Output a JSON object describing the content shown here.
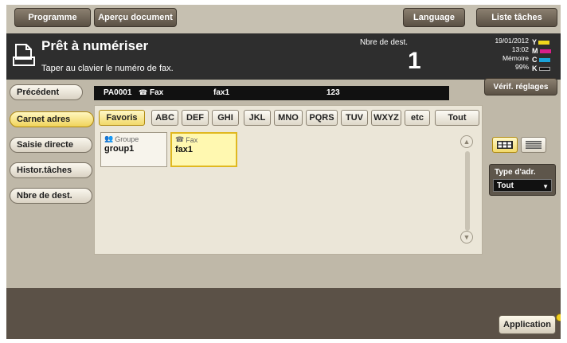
{
  "topbar": {
    "programme": "Programme",
    "apercu": "Aperçu document",
    "language": "Language",
    "liste_taches": "Liste tâches"
  },
  "status": {
    "title": "Prêt à numériser",
    "subtitle": "Taper au clavier le numéro de fax.",
    "dest_label": "Nbre de dest.",
    "dest_count": "1",
    "date": "19/01/2012",
    "time": "13:02",
    "memory_label": "Mémoire",
    "memory_value": "99%",
    "toner": [
      {
        "letter": "Y",
        "color": "#f1d71c"
      },
      {
        "letter": "M",
        "color": "#d81f8a"
      },
      {
        "letter": "C",
        "color": "#1aa3d9"
      },
      {
        "letter": "K",
        "color": "#111111"
      }
    ]
  },
  "nav": {
    "precedent": "Précédent",
    "carnet": "Carnet adres",
    "saisie": "Saisie directe",
    "histor": "Histor.tâches",
    "nbre": "Nbre de dest."
  },
  "faxbar": {
    "id": "PA0001",
    "type": "Fax",
    "name": "fax1",
    "number": "123"
  },
  "verif": "Vérif. réglages",
  "filters": [
    "Favoris",
    "ABC",
    "DEF",
    "GHI",
    "JKL",
    "MNO",
    "PQRS",
    "TUV",
    "WXYZ",
    "etc",
    "Tout"
  ],
  "addresses": [
    {
      "type": "Groupe",
      "name": "group1"
    },
    {
      "type": "Fax",
      "name": "fax1"
    }
  ],
  "type_adr": {
    "label": "Type d'adr.",
    "value": "Tout"
  },
  "application": "Application",
  "colors": {
    "accent_yellow": "#f2d96a",
    "panel_bg": "#ebe6d8",
    "status_bg": "#2e2e2e"
  }
}
